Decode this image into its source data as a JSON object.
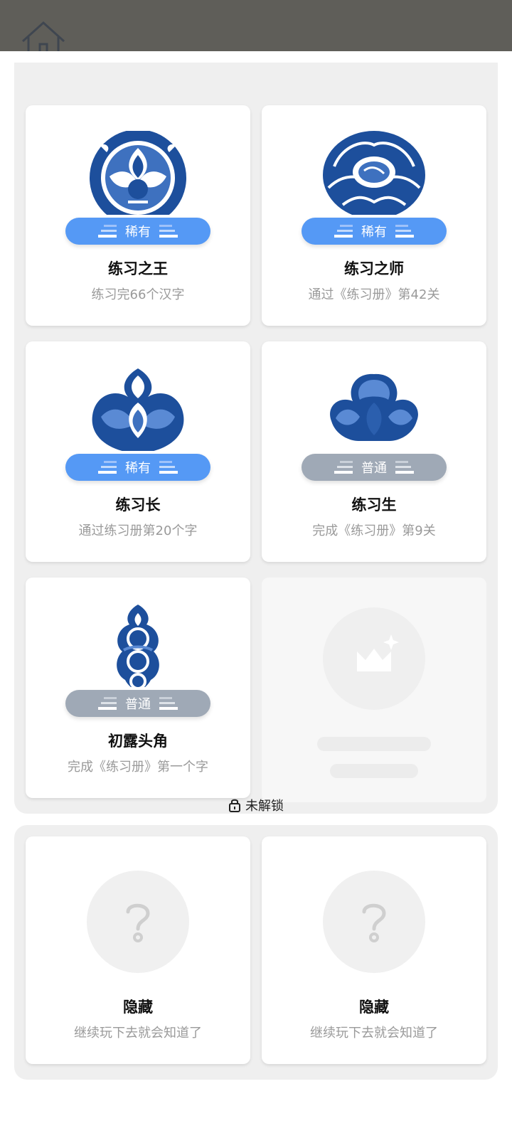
{
  "colors": {
    "rare": "#5599f5",
    "common": "#9fa9b6",
    "porcelain_blue": "#1d4f9c",
    "panel_bg": "#efefef"
  },
  "header": {
    "home_icon": "home-icon",
    "close_icon": "close-icon"
  },
  "unlocked": {
    "cards": [
      {
        "title": "练习之王",
        "desc": "练习完66个汉字",
        "rarity": "稀有",
        "rarity_type": "rare",
        "art": "medallion-flower-icon"
      },
      {
        "title": "练习之师",
        "desc": "通过《练习册》第42关",
        "rarity": "稀有",
        "rarity_type": "rare",
        "art": "peony-icon"
      },
      {
        "title": "练习长",
        "desc": "通过练习册第20个字",
        "rarity": "稀有",
        "rarity_type": "rare",
        "art": "lotus-icon"
      },
      {
        "title": "练习生",
        "desc": "完成《练习册》第9关",
        "rarity": "普通",
        "rarity_type": "common",
        "art": "blossom-icon"
      },
      {
        "title": "初露头角",
        "desc": "完成《练习册》第一个字",
        "rarity": "普通",
        "rarity_type": "common",
        "art": "ornament-icon"
      }
    ]
  },
  "locked": {
    "header": "未解锁",
    "cards": [
      {
        "title": "隐藏",
        "desc": "继续玩下去就会知道了",
        "icon": "question-mark-icon"
      },
      {
        "title": "隐藏",
        "desc": "继续玩下去就会知道了",
        "icon": "question-mark-icon"
      }
    ]
  }
}
